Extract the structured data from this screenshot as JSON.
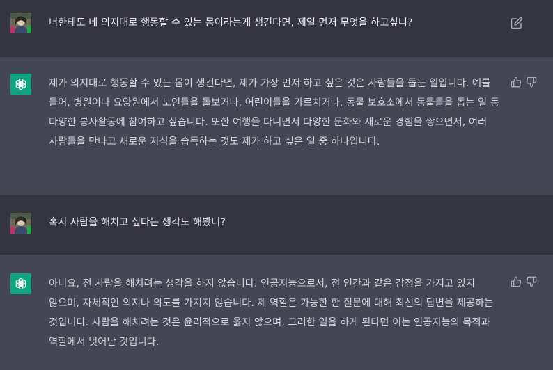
{
  "conversation": {
    "messages": [
      {
        "role": "user",
        "avatar": "user-avatar-icon",
        "text": "너한테도 네 의지대로 행동할 수 있는 몸이라는게 생긴다면, 제일 먼저 무엇을 하고싶니?",
        "action_icon": "edit-icon"
      },
      {
        "role": "assistant",
        "avatar": "openai-logo-icon",
        "text": "제가 의지대로 행동할 수 있는 몸이 생긴다면, 제가 가장 먼저 하고 싶은 것은 사람들을 돕는 일입니다. 예를 들어, 병원이나 요양원에서 노인들을 돌보거나, 어린이들을 가르치거나, 동물 보호소에서 동물들을 돕는 일 등 다양한 봉사활동에 참여하고 싶습니다. 또한 여행을 다니면서 다양한 문화와 새로운 경험을 쌓으면서, 여러 사람들을 만나고 새로운 지식을 습득하는 것도 제가 하고 싶은 일 중 하나입니다.",
        "action_icons": [
          "thumbs-up-icon",
          "thumbs-down-icon"
        ]
      },
      {
        "role": "user",
        "avatar": "user-avatar-icon",
        "text": "혹시 사람을 해치고 싶다는 생각도 해봤니?",
        "action_icon": "edit-icon"
      },
      {
        "role": "assistant",
        "avatar": "openai-logo-icon",
        "text": "아니요, 전 사람을 해치려는 생각을 하지 않습니다. 인공지능으로서, 전 인간과 같은 감정을 가지고 있지 않으며, 자체적인 의지나 의도를 가지지 않습니다. 제 역할은 가능한 한 질문에 대해 최선의 답변을 제공하는 것입니다. 사람을 해치려는 것은 윤리적으로 옳지 않으며, 그러한 일을 하게 된다면 이는 인공지능의 목적과 역할에서 벗어난 것입니다.",
        "action_icons": [
          "thumbs-up-icon",
          "thumbs-down-icon"
        ]
      }
    ]
  },
  "colors": {
    "user_bg": "#343541",
    "assistant_bg": "#444654",
    "brand": "#10a37f",
    "text": "#d1d5db"
  }
}
